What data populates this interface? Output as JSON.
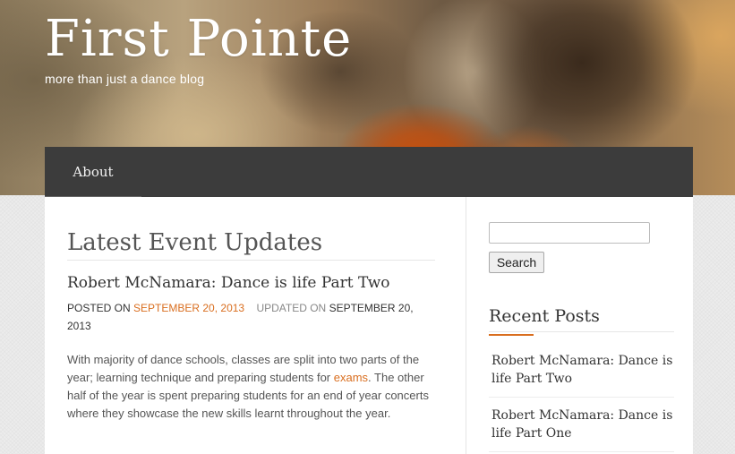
{
  "site": {
    "title": "First Pointe",
    "tagline": "more than just a dance blog"
  },
  "nav": {
    "items": [
      {
        "label": "About"
      }
    ]
  },
  "main": {
    "page_title": "Latest Event Updates",
    "post": {
      "title": "Robert McNamara: Dance is life Part Two",
      "meta": {
        "posted_label": "POSTED ON",
        "posted_date": "SEPTEMBER 20, 2013",
        "updated_label": "UPDATED ON",
        "updated_date": "SEPTEMBER 20, 2013"
      },
      "content": {
        "before_link": "With majority of dance schools, classes are split into two parts of the year; learning technique and preparing students for ",
        "link_text": "exams",
        "after_link": ". The other half of the year is spent preparing students for an end of year concerts where they showcase the new skills learnt throughout the year."
      }
    }
  },
  "sidebar": {
    "search": {
      "value": "",
      "button_label": "Search"
    },
    "recent_posts": {
      "title": "Recent Posts",
      "items": [
        {
          "label": "Robert McNamara: Dance is life Part Two"
        },
        {
          "label": "Robert McNamara: Dance is life Part One"
        }
      ]
    }
  },
  "colors": {
    "accent": "#d96e1f",
    "navbar": "#3c3c3c"
  }
}
